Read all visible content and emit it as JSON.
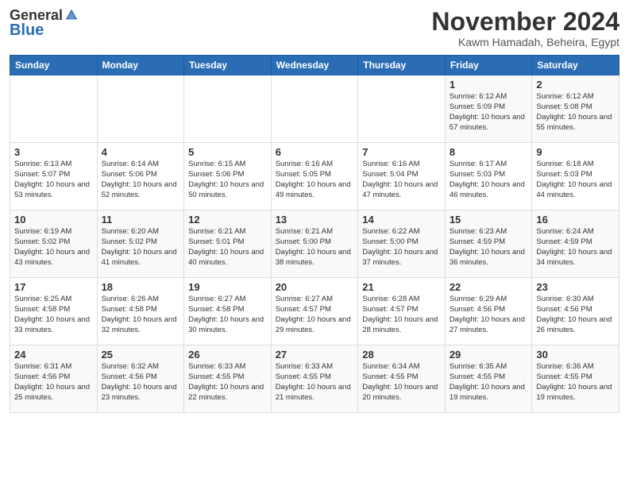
{
  "header": {
    "logo_general": "General",
    "logo_blue": "Blue",
    "month": "November 2024",
    "location": "Kawm Hamadah, Beheira, Egypt"
  },
  "weekdays": [
    "Sunday",
    "Monday",
    "Tuesday",
    "Wednesday",
    "Thursday",
    "Friday",
    "Saturday"
  ],
  "weeks": [
    [
      {
        "day": "",
        "info": ""
      },
      {
        "day": "",
        "info": ""
      },
      {
        "day": "",
        "info": ""
      },
      {
        "day": "",
        "info": ""
      },
      {
        "day": "",
        "info": ""
      },
      {
        "day": "1",
        "info": "Sunrise: 6:12 AM\nSunset: 5:09 PM\nDaylight: 10 hours and 57 minutes."
      },
      {
        "day": "2",
        "info": "Sunrise: 6:12 AM\nSunset: 5:08 PM\nDaylight: 10 hours and 55 minutes."
      }
    ],
    [
      {
        "day": "3",
        "info": "Sunrise: 6:13 AM\nSunset: 5:07 PM\nDaylight: 10 hours and 53 minutes."
      },
      {
        "day": "4",
        "info": "Sunrise: 6:14 AM\nSunset: 5:06 PM\nDaylight: 10 hours and 52 minutes."
      },
      {
        "day": "5",
        "info": "Sunrise: 6:15 AM\nSunset: 5:06 PM\nDaylight: 10 hours and 50 minutes."
      },
      {
        "day": "6",
        "info": "Sunrise: 6:16 AM\nSunset: 5:05 PM\nDaylight: 10 hours and 49 minutes."
      },
      {
        "day": "7",
        "info": "Sunrise: 6:16 AM\nSunset: 5:04 PM\nDaylight: 10 hours and 47 minutes."
      },
      {
        "day": "8",
        "info": "Sunrise: 6:17 AM\nSunset: 5:03 PM\nDaylight: 10 hours and 46 minutes."
      },
      {
        "day": "9",
        "info": "Sunrise: 6:18 AM\nSunset: 5:03 PM\nDaylight: 10 hours and 44 minutes."
      }
    ],
    [
      {
        "day": "10",
        "info": "Sunrise: 6:19 AM\nSunset: 5:02 PM\nDaylight: 10 hours and 43 minutes."
      },
      {
        "day": "11",
        "info": "Sunrise: 6:20 AM\nSunset: 5:02 PM\nDaylight: 10 hours and 41 minutes."
      },
      {
        "day": "12",
        "info": "Sunrise: 6:21 AM\nSunset: 5:01 PM\nDaylight: 10 hours and 40 minutes."
      },
      {
        "day": "13",
        "info": "Sunrise: 6:21 AM\nSunset: 5:00 PM\nDaylight: 10 hours and 38 minutes."
      },
      {
        "day": "14",
        "info": "Sunrise: 6:22 AM\nSunset: 5:00 PM\nDaylight: 10 hours and 37 minutes."
      },
      {
        "day": "15",
        "info": "Sunrise: 6:23 AM\nSunset: 4:59 PM\nDaylight: 10 hours and 36 minutes."
      },
      {
        "day": "16",
        "info": "Sunrise: 6:24 AM\nSunset: 4:59 PM\nDaylight: 10 hours and 34 minutes."
      }
    ],
    [
      {
        "day": "17",
        "info": "Sunrise: 6:25 AM\nSunset: 4:58 PM\nDaylight: 10 hours and 33 minutes."
      },
      {
        "day": "18",
        "info": "Sunrise: 6:26 AM\nSunset: 4:58 PM\nDaylight: 10 hours and 32 minutes."
      },
      {
        "day": "19",
        "info": "Sunrise: 6:27 AM\nSunset: 4:58 PM\nDaylight: 10 hours and 30 minutes."
      },
      {
        "day": "20",
        "info": "Sunrise: 6:27 AM\nSunset: 4:57 PM\nDaylight: 10 hours and 29 minutes."
      },
      {
        "day": "21",
        "info": "Sunrise: 6:28 AM\nSunset: 4:57 PM\nDaylight: 10 hours and 28 minutes."
      },
      {
        "day": "22",
        "info": "Sunrise: 6:29 AM\nSunset: 4:56 PM\nDaylight: 10 hours and 27 minutes."
      },
      {
        "day": "23",
        "info": "Sunrise: 6:30 AM\nSunset: 4:56 PM\nDaylight: 10 hours and 26 minutes."
      }
    ],
    [
      {
        "day": "24",
        "info": "Sunrise: 6:31 AM\nSunset: 4:56 PM\nDaylight: 10 hours and 25 minutes."
      },
      {
        "day": "25",
        "info": "Sunrise: 6:32 AM\nSunset: 4:56 PM\nDaylight: 10 hours and 23 minutes."
      },
      {
        "day": "26",
        "info": "Sunrise: 6:33 AM\nSunset: 4:55 PM\nDaylight: 10 hours and 22 minutes."
      },
      {
        "day": "27",
        "info": "Sunrise: 6:33 AM\nSunset: 4:55 PM\nDaylight: 10 hours and 21 minutes."
      },
      {
        "day": "28",
        "info": "Sunrise: 6:34 AM\nSunset: 4:55 PM\nDaylight: 10 hours and 20 minutes."
      },
      {
        "day": "29",
        "info": "Sunrise: 6:35 AM\nSunset: 4:55 PM\nDaylight: 10 hours and 19 minutes."
      },
      {
        "day": "30",
        "info": "Sunrise: 6:36 AM\nSunset: 4:55 PM\nDaylight: 10 hours and 19 minutes."
      }
    ]
  ]
}
